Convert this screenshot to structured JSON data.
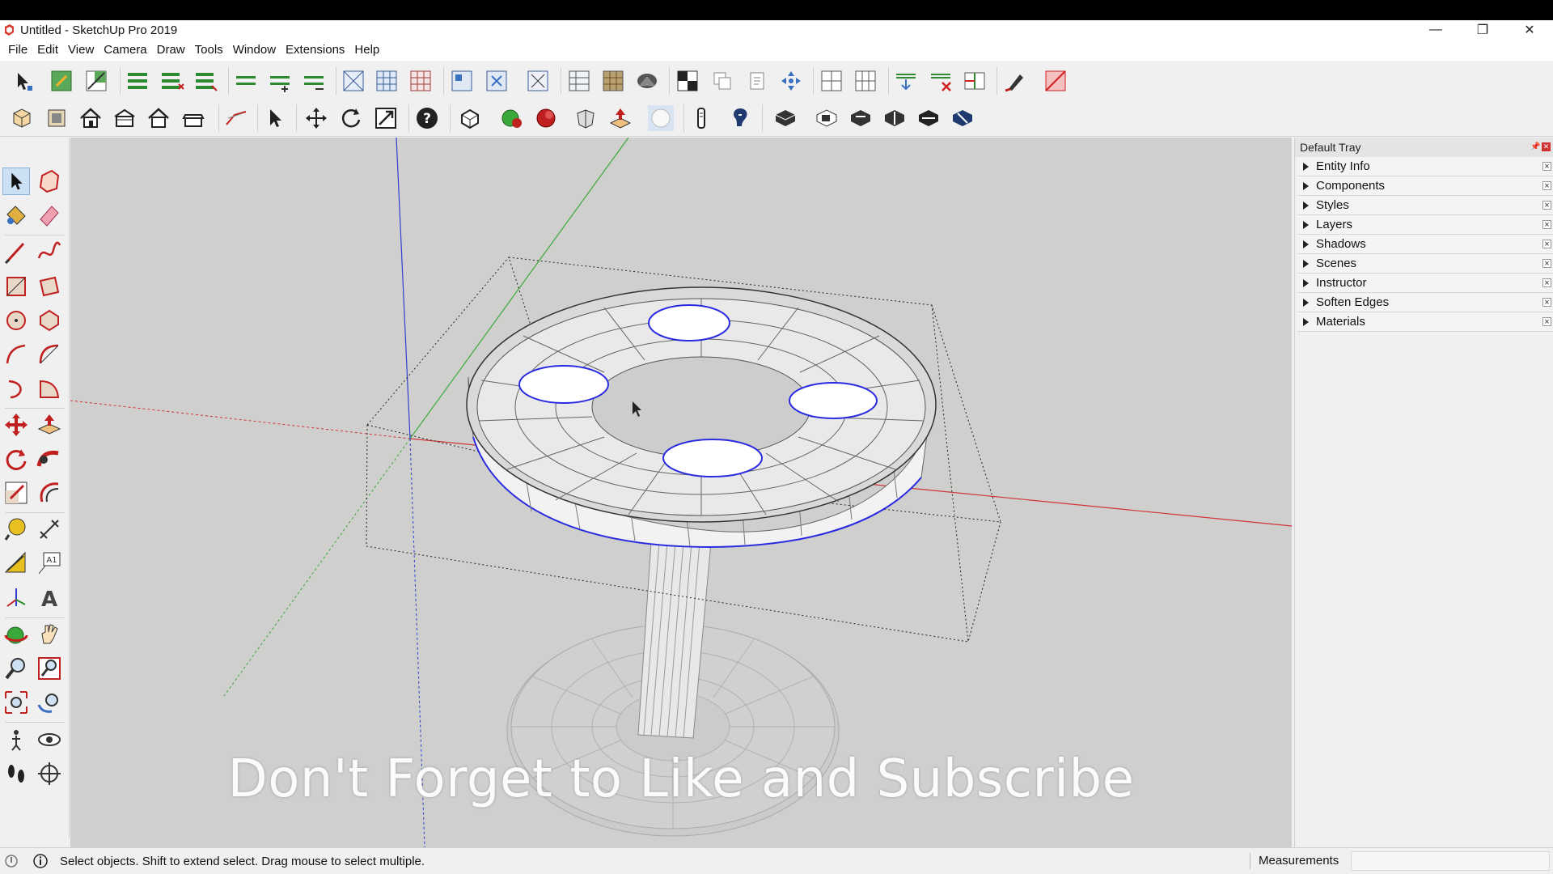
{
  "window": {
    "title": "Untitled - SketchUp Pro 2019",
    "minimize": "—",
    "restore": "❐",
    "close": "✕"
  },
  "menu": [
    "File",
    "Edit",
    "View",
    "Camera",
    "Draw",
    "Tools",
    "Window",
    "Extensions",
    "Help"
  ],
  "tray": {
    "title": "Default Tray",
    "panels": [
      "Entity Info",
      "Components",
      "Styles",
      "Layers",
      "Shadows",
      "Scenes",
      "Instructor",
      "Soften Edges",
      "Materials"
    ]
  },
  "viewport": {
    "overlay_text": "Don't Forget to Like and Subscribe",
    "colors": {
      "background": "#cfcfcd",
      "red_axis": "#d03535",
      "green_axis": "#3aa83a",
      "blue_axis": "#2f3fd0",
      "selection": "#2a2ae0",
      "face": "#f4f4f4"
    }
  },
  "status": {
    "hint": "Select objects. Shift to extend select. Drag mouse to select multiple.",
    "measurements_label": "Measurements",
    "measurements_value": ""
  }
}
